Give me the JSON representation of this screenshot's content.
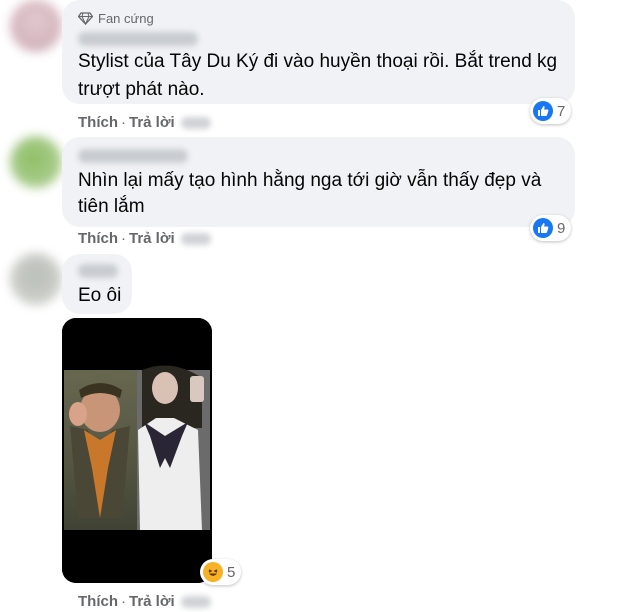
{
  "comments": [
    {
      "badge": "Fan cứng",
      "text_lines": [
        "Stylist của Tây Du Ký đi vào huyền thoại rồi. Bắt trend kg",
        "trượt phát nào."
      ],
      "like_label": "Thích",
      "reply_label": "Trả lời",
      "reaction_count": "7"
    },
    {
      "text_lines": [
        "Nhìn lại mấy tạo hình hằng nga tới giờ vẫn thấy đẹp và",
        "tiên lắm"
      ],
      "like_label": "Thích",
      "reply_label": "Trả lời",
      "reaction_count": "9"
    },
    {
      "text_lines": [
        "Eo ôi"
      ],
      "like_label": "Thích",
      "reply_label": "Trả lời",
      "reaction_count": "5"
    }
  ],
  "colors": {
    "bubble": "#f0f2f5",
    "like_blue": "#1877f2",
    "haha_yellow": "#f7b125",
    "meta_gray": "#65676b"
  }
}
